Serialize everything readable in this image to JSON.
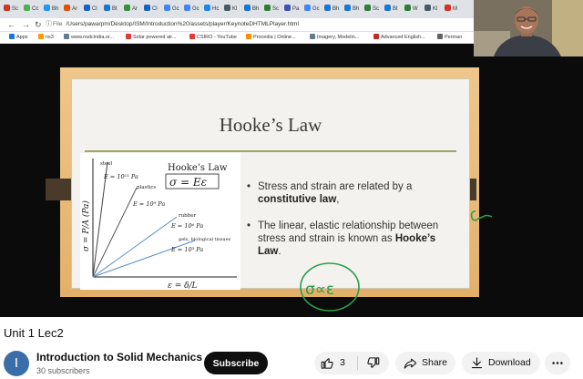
{
  "browser": {
    "tabs": [
      "Sc",
      "Cc",
      "Bh",
      "Ar",
      "Cl",
      "Bt",
      "Ar",
      "Cl",
      "Gc",
      "Gc",
      "Hc",
      "Kl",
      "Bh",
      "Sc",
      "Pa",
      "Gc",
      "Bh",
      "Bh",
      "Sc",
      "Bt",
      "W",
      "Kl",
      "M"
    ],
    "tab_colors": [
      "#d93025",
      "#4caf50",
      "#2196f3",
      "#e65100",
      "#1565c0",
      "#1976d2",
      "#388e3c",
      "#1565c0",
      "#4285f4",
      "#4285f4",
      "#1e88e5",
      "#455a64",
      "#1976d2",
      "#2e7d32",
      "#3f51b5",
      "#4285f4",
      "#1976d2",
      "#1976d2",
      "#2e7d32",
      "#1976d2",
      "#2e7d32",
      "#455a64",
      "#d93025"
    ],
    "url_prefix": "File",
    "url": "/Users/pawarpm/Desktop/ISM/Introduction%20/assets/player/KeynoteDHTMLPlayer.html",
    "bookmarks": [
      "Apps",
      "ns3",
      "www.nsdcindia.or...",
      "Solar powered air...",
      "CSIRO - YouTube",
      "Procedia | Online...",
      "Imagery, Modelin...",
      "Advanced English...",
      "Perman"
    ],
    "bookmark_colors": [
      "#1a73e8",
      "#ff9800",
      "#607d8b",
      "#e53935",
      "#e53935",
      "#fb8c00",
      "#607d8b",
      "#c62828",
      "#616161"
    ]
  },
  "slide": {
    "title": "Hooke’s Law",
    "figure": {
      "ylabel": "σ = P/A (Pa)",
      "xlabel": "ε = δ/L",
      "legend_title": "Hooke’s Law",
      "formula": "σ = Eε",
      "labels": [
        "steel",
        "E = 10¹¹ Pa",
        "plastics",
        "E = 10⁹ Pa",
        "rubber",
        "E = 10⁶ Pa",
        "gels, biological tissues",
        "E = 10³ Pa"
      ]
    },
    "bullets": [
      {
        "before": "Stress and strain are related by a ",
        "bold": "constitutive law",
        "after": ","
      },
      {
        "before": "The linear, elastic relationship between stress and strain is known as ",
        "bold": "Hooke’s Law",
        "after": "."
      }
    ],
    "annotation": "σ∝ε",
    "ink_color": "#2a9d4a"
  },
  "video": {
    "title": "Unit 1 Lec2"
  },
  "channel": {
    "avatar_letter": "I",
    "name": "Introduction to Solid Mechanics",
    "subscribers": "30 subscribers"
  },
  "actions": {
    "subscribe": "Subscribe",
    "like_count": "3",
    "share": "Share",
    "download": "Download"
  },
  "icons": [
    "back-icon",
    "forward-icon",
    "reload-icon",
    "info-icon",
    "like-icon",
    "dislike-icon",
    "share-icon",
    "download-icon",
    "more-icon"
  ]
}
